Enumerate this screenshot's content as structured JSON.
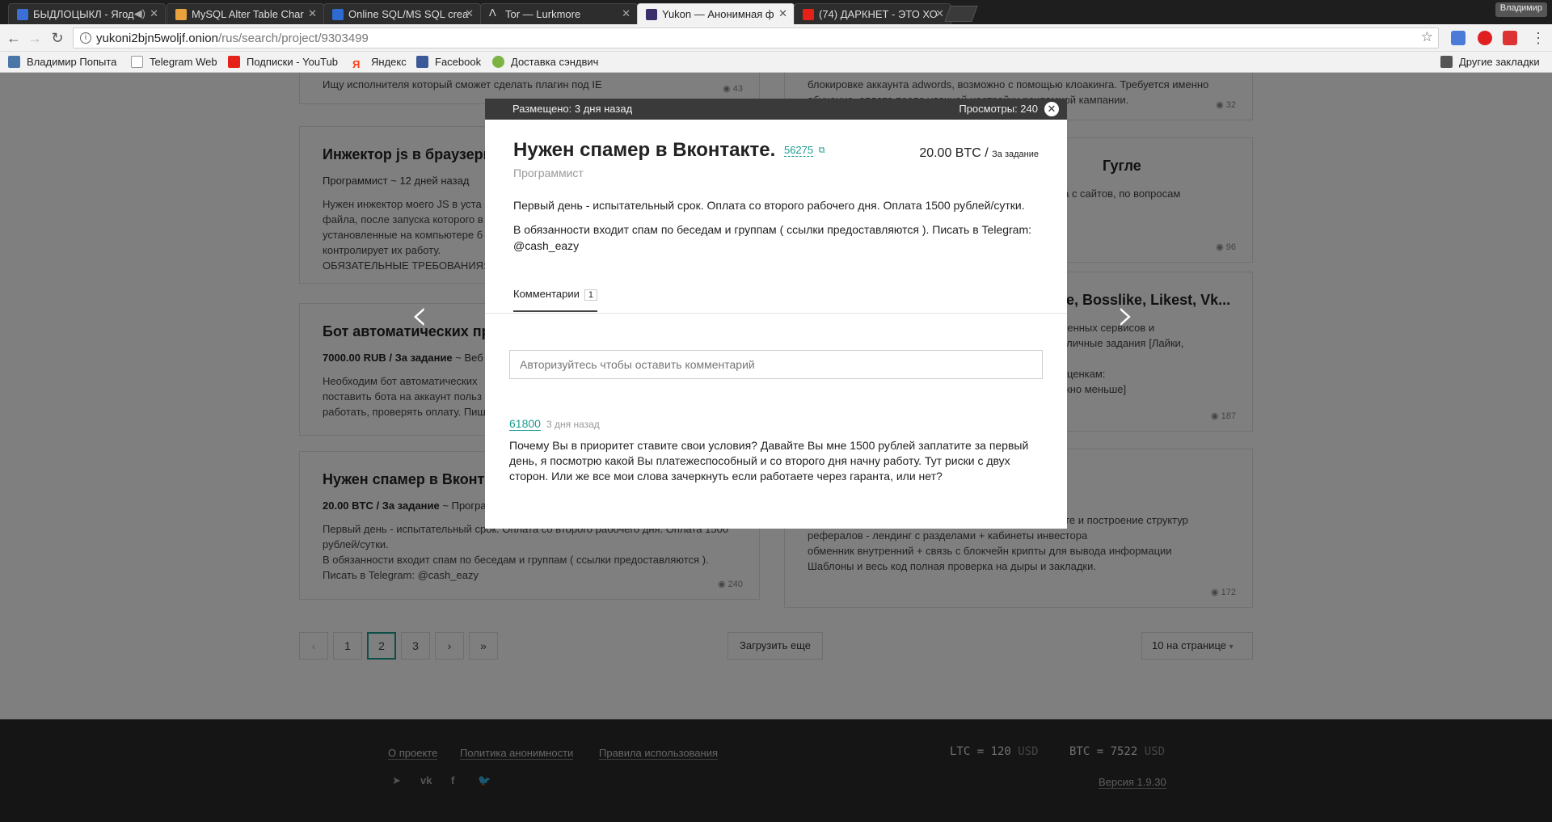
{
  "browser": {
    "tabs": [
      {
        "title": "БЫДЛОЦЫКЛ - Ягод",
        "color": "#3b6fd6"
      },
      {
        "title": "MySQL Alter Table Char",
        "color": "#e8a33d"
      },
      {
        "title": "Online SQL/MS SQL crea",
        "color": "#2d6bd1"
      },
      {
        "title": "Tor — Lurkmore",
        "color": "#dddddd"
      },
      {
        "title": "Yukon — Анонимная ф",
        "color": "#3a2f6b"
      },
      {
        "title": "(74) ДАРКНЕТ - ЭТО ХО",
        "color": "#e62117"
      }
    ],
    "profile": "Владимир",
    "url_host": "yukoni2bjn5woljf.onion",
    "url_path": "/rus/search/project/9303499",
    "bookmarks": [
      {
        "label": "Владимир Попыта",
        "color": "#4a76a8"
      },
      {
        "label": "Telegram Web",
        "color": "#e0e0e0"
      },
      {
        "label": "Подписки - YouTub",
        "color": "#e62117"
      },
      {
        "label": "Яндекс",
        "color": "#fc3f1d"
      },
      {
        "label": "Facebook",
        "color": "#3b5998"
      },
      {
        "label": "Доставка сэндвич",
        "color": "#7cb342"
      }
    ],
    "other_bookmarks": "Другие закладки"
  },
  "cards": [
    {
      "title": "",
      "meta": "",
      "text": "Ищу исполнителя который сможет сделать плагин под IE",
      "views": "43"
    },
    {
      "title": "Инжектор js в браузеры",
      "meta_a": "Программист",
      "meta_b": "12 дней назад",
      "text": "Нужен инжектор моего JS в уста\nфайла, после запуска которого в\nустановленные на компьютере б\nконтролирует их работу.\nОБЯЗАТЕЛЬНЫЕ ТРЕБОВАНИЯ:",
      "views": ""
    },
    {
      "title": "Бот автоматических про",
      "meta_a": "7000.00 RUB / За задание",
      "meta_b": "Веб",
      "text": "Необходим бот автоматических\nпоставить бота на аккаунт польз\nработать, проверять оплату. Пиш",
      "views": ""
    },
    {
      "title": "Нужен спамер в Вконта",
      "meta_a": "20.00 BTC / За задание",
      "meta_b": "Програ",
      "text": "Первый день - испытательный срок. Оплата со второго рабочего дня. Оплата 1500\nрублей/сутки.\nВ обязанности входит спам по беседам и группам ( ссылки предоставляются ).\nПисать в Telegram: @cash_eazy",
      "views": "240"
    },
    {
      "title": "",
      "text": "блокировке аккаунта adwords, возможно с помощью клоакинга. Требуется именно\nобучение, оплата после удачной настройки рекламной кампании.",
      "views": "32"
    },
    {
      "title": "Гугле",
      "text": "ыва с сайтов, по вопросам",
      "views": "96"
    },
    {
      "title": "ke, Bosslike, Likest, Vk...",
      "text": "исленных сервисов и\nразличные задания [Лайки,\n\nрасценкам:\nможно меньше]",
      "views": "187"
    },
    {
      "title": "н",
      "text": "алюта - инвестиции\n( майнинг PoS)— автоматизация регистрации в крипте и построение структур\nрефералов - лендинг с разделами + кабинеты инвестора\nобменник внутренний + связь с блокчейн крипты для вывода информации\nШаблоны и весь код полная проверка на дыры и закладки.",
      "views": "172"
    }
  ],
  "pagination": {
    "pages": [
      "1",
      "2",
      "3"
    ],
    "current": "2",
    "load_more": "Загрузить еще",
    "per_page": "10 на странице"
  },
  "footer": {
    "links": [
      "О проекте",
      "Политика анонимности",
      "Правила использования"
    ],
    "ltc_label": "LTC = 120",
    "ltc_unit": "USD",
    "btc_label": "BTC = 7522",
    "btc_unit": "USD",
    "version": "Версия 1.9.30"
  },
  "modal": {
    "posted": "Размещено: 3 дня назад",
    "views": "Просмотры: 240",
    "title": "Нужен спамер в Вконтакте.",
    "user_id": "56275",
    "category": "Программист",
    "price": "20.00 BTC /",
    "price_unit": "За задание",
    "desc_1": "Первый день - испытательный срок. Оплата со второго рабочего дня. Оплата 1500 рублей/сутки.",
    "desc_2": "В обязанности входит спам по беседам и группам ( ссылки предоставляются ). Писать в Telegram: @cash_eazy",
    "comments_tab": "Комментарии",
    "comments_count": "1",
    "comment_placeholder": "Авторизуйтесь чтобы оставить комментарий",
    "comment_user": "61800",
    "comment_time": "3 дня назад",
    "comment_text": "Почему Вы в приоритет ставите свои условия? Давайте Вы мне 1500 рублей заплатите за первый день, я посмотрю какой Вы платежеспособный и со второго дня начну работу. Тут риски с двух сторон. Или же все мои слова зачеркнуть если работаете через гаранта, или нет?"
  },
  "accent_color": "#1a9c8f"
}
